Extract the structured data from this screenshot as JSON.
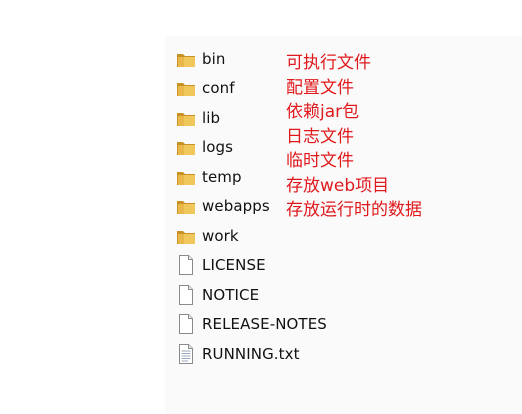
{
  "files": [
    {
      "name": "bin",
      "icon": "folder-icon"
    },
    {
      "name": "conf",
      "icon": "folder-icon"
    },
    {
      "name": "lib",
      "icon": "folder-icon"
    },
    {
      "name": "logs",
      "icon": "folder-icon"
    },
    {
      "name": "temp",
      "icon": "folder-icon"
    },
    {
      "name": "webapps",
      "icon": "folder-icon"
    },
    {
      "name": "work",
      "icon": "folder-icon"
    },
    {
      "name": "LICENSE",
      "icon": "file-icon"
    },
    {
      "name": "NOTICE",
      "icon": "file-icon"
    },
    {
      "name": "RELEASE-NOTES",
      "icon": "file-icon"
    },
    {
      "name": "RUNNING.txt",
      "icon": "text-file-icon"
    }
  ],
  "annotations": [
    "可执行文件",
    "配置文件",
    "依赖jar包",
    "日志文件",
    "临时文件",
    "存放web项目",
    "存放运行时的数据"
  ],
  "colors": {
    "annotation": "#e0191d",
    "folder": "#e8b94a",
    "folder_dark": "#c99024",
    "text": "#111111"
  }
}
